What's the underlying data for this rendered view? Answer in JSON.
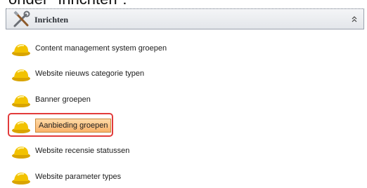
{
  "caption": "onder \"Inrichten\":",
  "header": {
    "title": "Inrichten",
    "icon": "tools-icon",
    "collapse_icon": "chevron-up-double-icon"
  },
  "items": [
    {
      "label": "Content management system groepen",
      "icon": "hard-hat-icon",
      "selected": false
    },
    {
      "label": "Website nieuws categorie typen",
      "icon": "hard-hat-icon",
      "selected": false
    },
    {
      "label": "Banner groepen",
      "icon": "hard-hat-icon",
      "selected": false
    },
    {
      "label": "Aanbieding groepen",
      "icon": "hard-hat-icon",
      "selected": true
    },
    {
      "label": "Website recensie statussen",
      "icon": "hard-hat-icon",
      "selected": false
    },
    {
      "label": "Website parameter types",
      "icon": "hard-hat-icon",
      "selected": false
    }
  ],
  "colors": {
    "highlight_border": "#e23b3b",
    "selected_background": "#f9b36a",
    "hat_yellow": "#f2c200"
  }
}
